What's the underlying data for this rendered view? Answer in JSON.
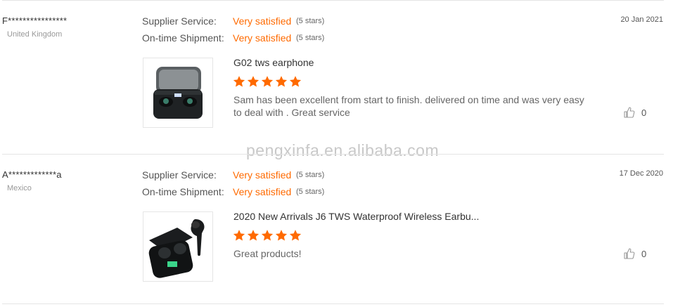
{
  "watermark": "pengxinfa.en.alibaba.com",
  "reviews": [
    {
      "buyer": "F****************",
      "country": "United Kingdom",
      "date": "20 Jan 2021",
      "supplier_service_label": "Supplier Service:",
      "supplier_service_value": "Very satisfied",
      "supplier_service_stars": "(5 stars)",
      "shipment_label": "On-time Shipment:",
      "shipment_value": "Very satisfied",
      "shipment_stars": "(5 stars)",
      "product_title": "G02 tws earphone",
      "rating": 5,
      "comment": "Sam has been excellent from start to finish. delivered on time and was very easy to deal with . Great service",
      "likes": "0"
    },
    {
      "buyer": "A*************a",
      "country": "Mexico",
      "date": "17 Dec 2020",
      "supplier_service_label": "Supplier Service:",
      "supplier_service_value": "Very satisfied",
      "supplier_service_stars": "(5 stars)",
      "shipment_label": "On-time Shipment:",
      "shipment_value": "Very satisfied",
      "shipment_stars": "(5 stars)",
      "product_title": "2020 New Arrivals J6 TWS Waterproof Wireless Earbu...",
      "rating": 5,
      "comment": "Great products!",
      "likes": "0"
    }
  ],
  "colors": {
    "accent": "#ff6a00",
    "divider": "#e4e4e4"
  },
  "icons": {
    "like": "thumbs-up-icon",
    "star": "star-icon"
  }
}
